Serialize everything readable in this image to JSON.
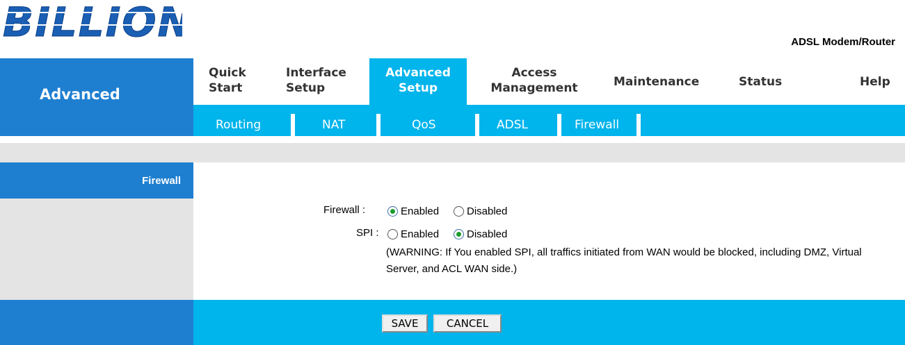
{
  "header": {
    "logo_text": "BILLION",
    "product_label": "ADSL Modem/Router"
  },
  "section": {
    "title": "Advanced"
  },
  "main_nav": {
    "quick_start": [
      "Quick",
      "Start"
    ],
    "interface_setup": [
      "Interface",
      "Setup"
    ],
    "advanced_setup": [
      "Advanced",
      "Setup"
    ],
    "access_management": [
      "Access",
      "Management"
    ],
    "maintenance": "Maintenance",
    "status": "Status",
    "help": "Help"
  },
  "sub_nav": {
    "items": [
      "Routing",
      "NAT",
      "QoS",
      "ADSL",
      "Firewall"
    ]
  },
  "sidebar": {
    "current": "Firewall"
  },
  "form": {
    "firewall_label": "Firewall :",
    "firewall_value": "Enabled",
    "spi_label": "SPI :",
    "spi_value": "Disabled",
    "enabled_label": "Enabled",
    "disabled_label": "Disabled",
    "warning": "(WARNING: If You enabled SPI, all traffics initiated from WAN would be blocked, including DMZ, Virtual Server, and ACL WAN side.)"
  },
  "buttons": {
    "save": "SAVE",
    "cancel": "CANCEL"
  },
  "colors": {
    "brand_blue": "#1e7fd0",
    "accent_cyan": "#00b4ec",
    "panel_grey": "#e4e4e4",
    "logo_blue": "#1a5fb4"
  }
}
